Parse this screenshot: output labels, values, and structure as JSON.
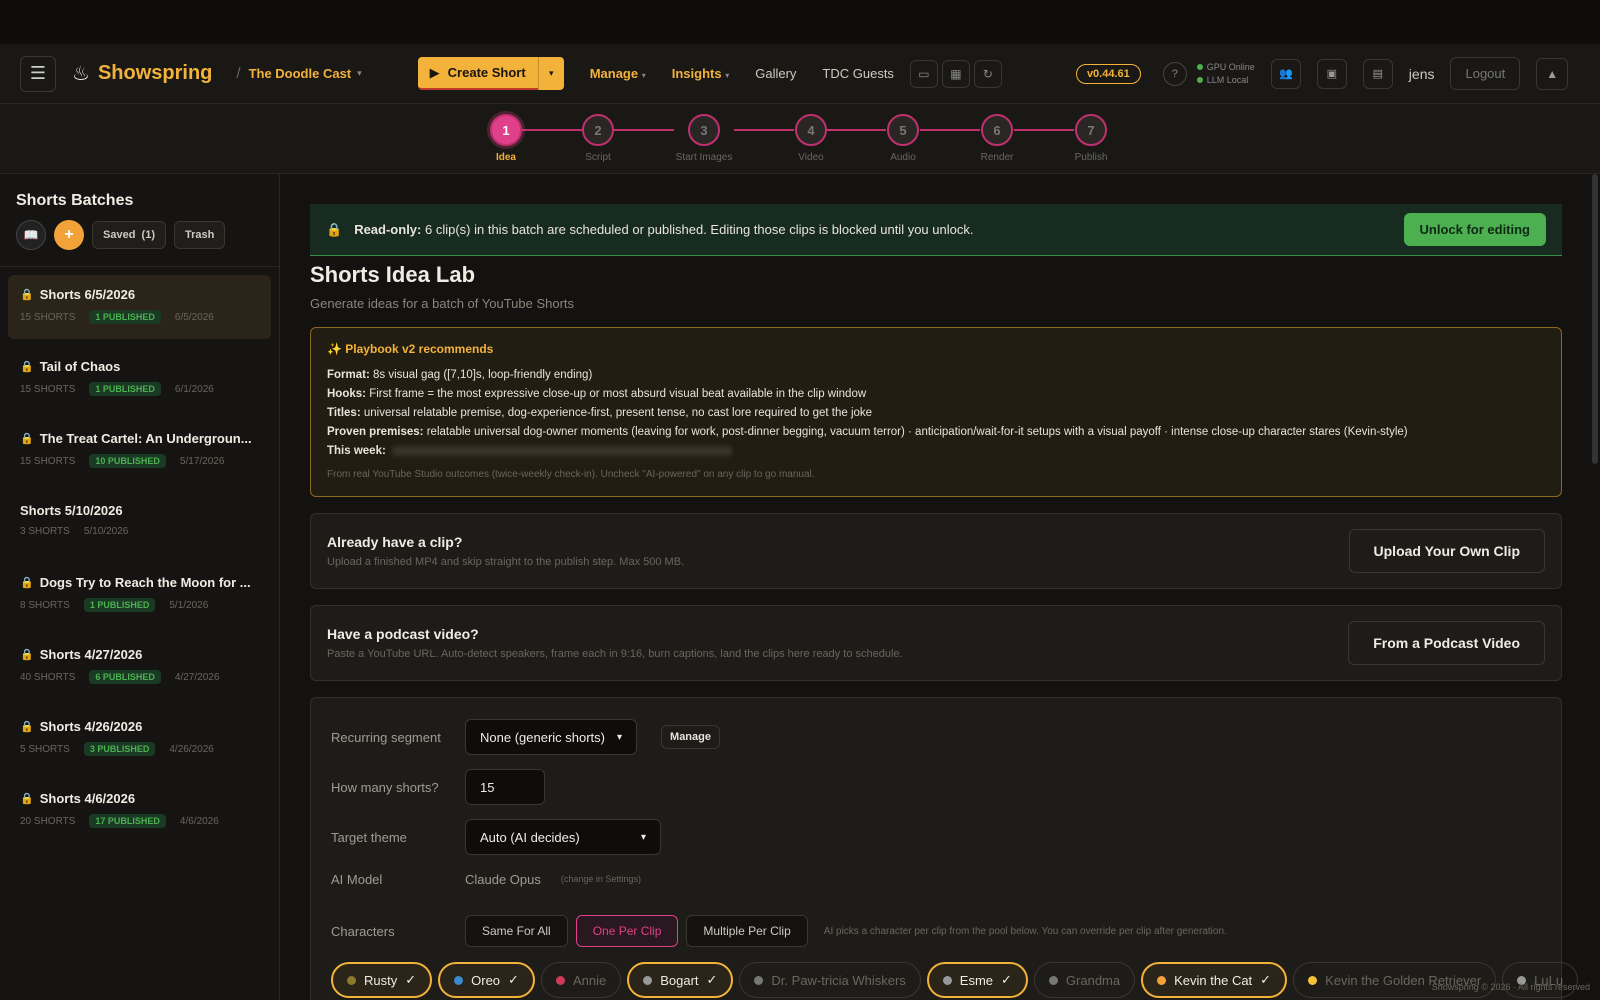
{
  "nav": {
    "menu_icon": "hamburger-icon",
    "logo_text": "Showspring",
    "channel": "The Doodle Cast",
    "create_label": "Create Short",
    "links": [
      "Manage",
      "Insights",
      "Gallery",
      "TDC Guests"
    ],
    "version": "v0.44.61",
    "help": "?",
    "gpu_status": "GPU Online",
    "llm_status": "LLM Local",
    "user": "jens",
    "logout": "Logout",
    "accent": "#f3b23a"
  },
  "steps": [
    {
      "num": "1",
      "label": "Idea"
    },
    {
      "num": "2",
      "label": "Script"
    },
    {
      "num": "3",
      "label": "Start Images"
    },
    {
      "num": "4",
      "label": "Video"
    },
    {
      "num": "5",
      "label": "Audio"
    },
    {
      "num": "6",
      "label": "Render"
    },
    {
      "num": "7",
      "label": "Publish"
    }
  ],
  "sidebar": {
    "title": "Shorts Batches",
    "saved_label": "Saved",
    "saved_count": "(1)",
    "trash_label": "Trash",
    "batches": [
      {
        "title": "Shorts 6/5/2026",
        "count": "15 SHORTS",
        "published": "1 PUBLISHED",
        "date": "6/5/2026",
        "locked": true
      },
      {
        "title": "Tail of Chaos",
        "count": "15 SHORTS",
        "published": "1 PUBLISHED",
        "date": "6/1/2026",
        "locked": true
      },
      {
        "title": "The Treat Cartel: An Undergroun...",
        "count": "15 SHORTS",
        "published": "10 PUBLISHED",
        "date": "5/17/2026",
        "locked": true
      },
      {
        "title": "Shorts 5/10/2026",
        "count": "3 SHORTS",
        "published": "",
        "date": "5/10/2026",
        "locked": false
      },
      {
        "title": "Dogs Try to Reach the Moon for ...",
        "count": "8 SHORTS",
        "published": "1 PUBLISHED",
        "date": "5/1/2026",
        "locked": true
      },
      {
        "title": "Shorts 4/27/2026",
        "count": "40 SHORTS",
        "published": "6 PUBLISHED",
        "date": "4/27/2026",
        "locked": true
      },
      {
        "title": "Shorts 4/26/2026",
        "count": "5 SHORTS",
        "published": "3 PUBLISHED",
        "date": "4/26/2026",
        "locked": true
      },
      {
        "title": "Shorts 4/6/2026",
        "count": "20 SHORTS",
        "published": "17 PUBLISHED",
        "date": "4/6/2026",
        "locked": true
      }
    ]
  },
  "readonly": {
    "bold": "Read-only:",
    "text": "6 clip(s) in this batch are scheduled or published. Editing those clips is blocked until you unlock.",
    "button": "Unlock for editing"
  },
  "lab": {
    "title": "Shorts Idea Lab",
    "subtitle": "Generate ideas for a batch of YouTube Shorts"
  },
  "playbook": {
    "head": "Playbook v2 recommends",
    "format_k": "Format:",
    "format_v": "8s visual gag ([7,10]s, loop-friendly ending)",
    "hooks_k": "Hooks:",
    "hooks_v": "First frame = the most expressive close-up or most absurd visual beat available in the clip window",
    "titles_k": "Titles:",
    "titles_v": "universal relatable premise, dog-experience-first, present tense, no cast lore required to get the joke",
    "premises_k": "Proven premises:",
    "premises_v": "relatable universal dog-owner moments (leaving for work, post-dinner begging, vacuum terror) · anticipation/wait-for-it setups with a visual payoff · intense close-up character stares (Kevin-style)",
    "week_k": "This week:",
    "foot": "From real YouTube Studio outcomes (twice-weekly check-in). Uncheck \"AI-powered\" on any clip to go manual."
  },
  "upload_card": {
    "title": "Already have a clip?",
    "sub": "Upload a finished MP4 and skip straight to the publish step. Max 500 MB.",
    "button": "Upload Your Own Clip"
  },
  "podcast_card": {
    "title": "Have a podcast video?",
    "sub": "Paste a YouTube URL. Auto-detect speakers, frame each in 9:16, burn captions, land the clips here ready to schedule.",
    "button": "From a Podcast Video"
  },
  "form": {
    "segment_label": "Recurring segment",
    "segment_value": "None (generic shorts)",
    "manage": "Manage",
    "count_label": "How many shorts?",
    "count_value": "15",
    "theme_label": "Target theme",
    "theme_value": "Auto (AI decides)",
    "model_label": "AI Model",
    "model_value": "Claude Opus",
    "model_hint": "(change in Settings)",
    "chars_label": "Characters",
    "modes": [
      "Same For All",
      "One Per Clip",
      "Multiple Per Clip"
    ],
    "chars_hint": "AI picks a character per clip from the pool below. You can override per clip after generation."
  },
  "characters": [
    {
      "name": "Rusty",
      "on": true,
      "color": "#8a7a2a"
    },
    {
      "name": "Oreo",
      "on": true,
      "color": "#3a8ad0"
    },
    {
      "name": "Annie",
      "on": false,
      "color": "#d03a5a"
    },
    {
      "name": "Bogart",
      "on": true,
      "color": "#999999"
    },
    {
      "name": "Dr. Paw-tricia Whiskers",
      "on": false,
      "color": "#777777"
    },
    {
      "name": "Esme",
      "on": true,
      "color": "#999999"
    },
    {
      "name": "Grandma",
      "on": false,
      "color": "#777777"
    },
    {
      "name": "Kevin the Cat",
      "on": true,
      "color": "#f3a23a"
    },
    {
      "name": "Kevin the Golden Retriever",
      "on": false,
      "color": "#f3c23a"
    },
    {
      "name": "LuLu",
      "on": false,
      "color": "#999999"
    }
  ],
  "footer": "Showspring © 2026 · All rights reserved"
}
